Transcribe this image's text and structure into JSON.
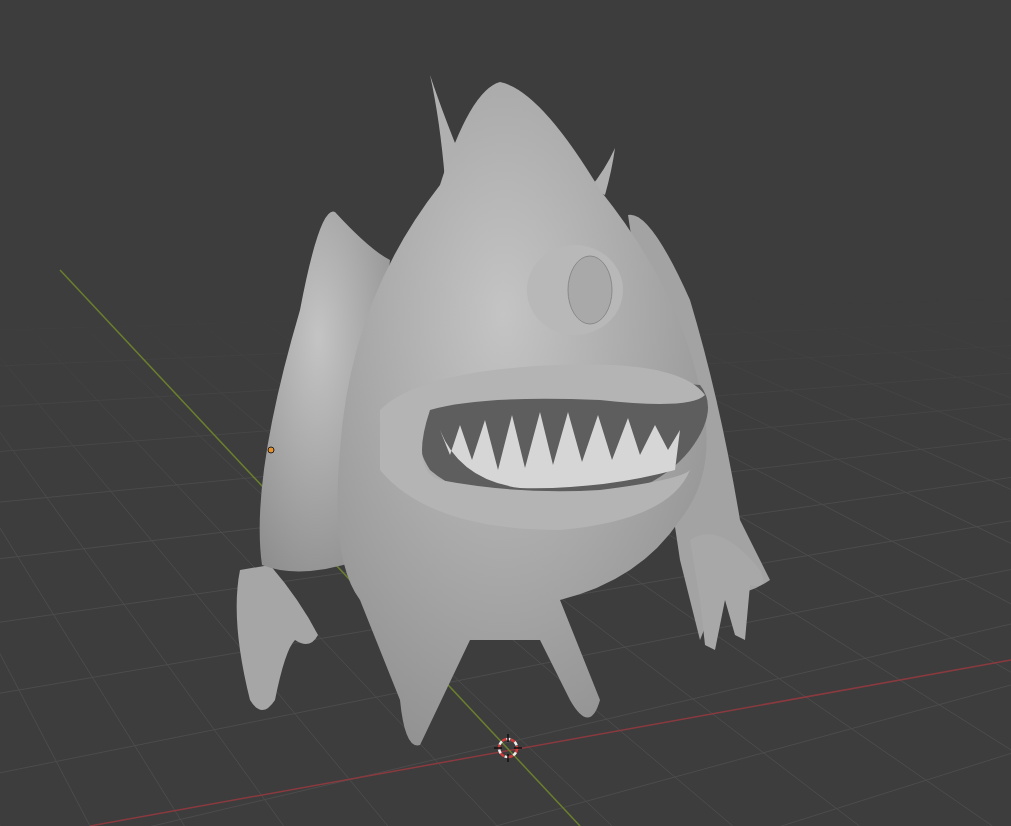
{
  "viewport": {
    "show_floor_grid": true,
    "show_axes": true,
    "show_3d_cursor": true,
    "show_origin": true
  }
}
